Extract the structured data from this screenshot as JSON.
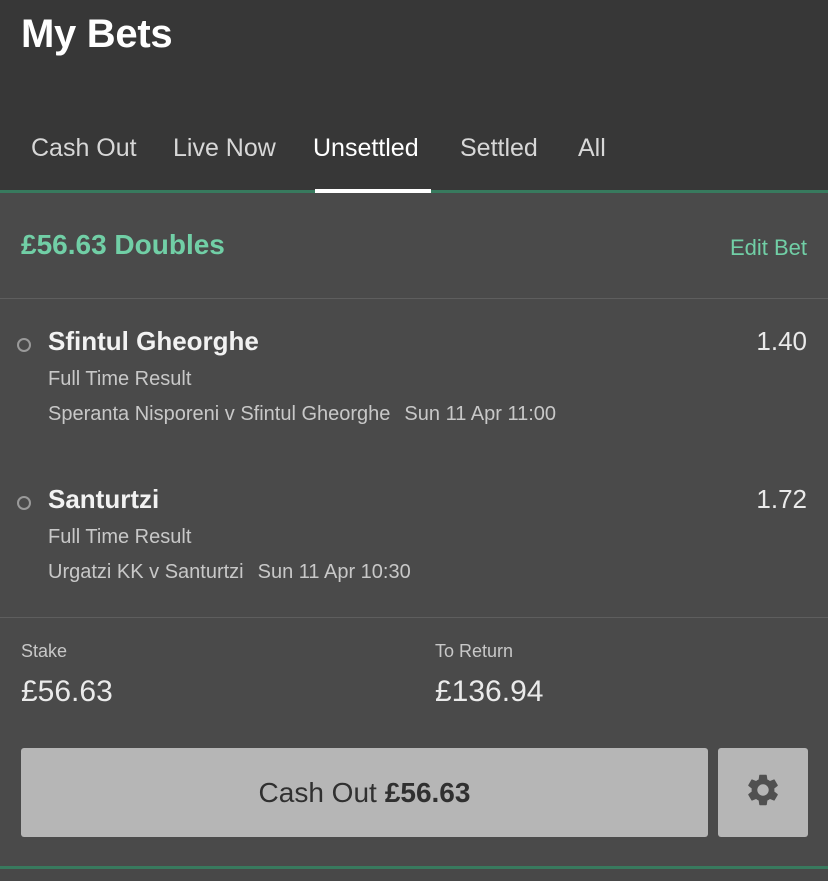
{
  "header": {
    "title": "My Bets"
  },
  "tabs": [
    {
      "label": "Cash Out",
      "active": false
    },
    {
      "label": "Live Now",
      "active": false
    },
    {
      "label": "Unsettled",
      "active": true
    },
    {
      "label": "Settled",
      "active": false
    },
    {
      "label": "All",
      "active": false
    }
  ],
  "bet": {
    "title": "£56.63 Doubles",
    "edit_label": "Edit Bet",
    "selections": [
      {
        "name": "Sfintul Gheorghe",
        "odds": "1.40",
        "market": "Full Time Result",
        "event": "Speranta Nisporeni v Sfintul Gheorghe",
        "time": "Sun 11 Apr 11:00"
      },
      {
        "name": "Santurtzi",
        "odds": "1.72",
        "market": "Full Time Result",
        "event": "Urgatzi KK v Santurtzi",
        "time": "Sun 11 Apr 10:30"
      }
    ],
    "stake_label": "Stake",
    "stake_value": "£56.63",
    "return_label": "To Return",
    "return_value": "£136.94",
    "cashout_label": "Cash Out",
    "cashout_amount": "£56.63",
    "settings_icon": "gear-icon"
  },
  "colors": {
    "accent_green": "#71cfa6",
    "rule_green": "#387a5e",
    "header_bg": "#373737",
    "card_bg": "#4a4a4a",
    "button_bg": "#b6b6b6"
  }
}
